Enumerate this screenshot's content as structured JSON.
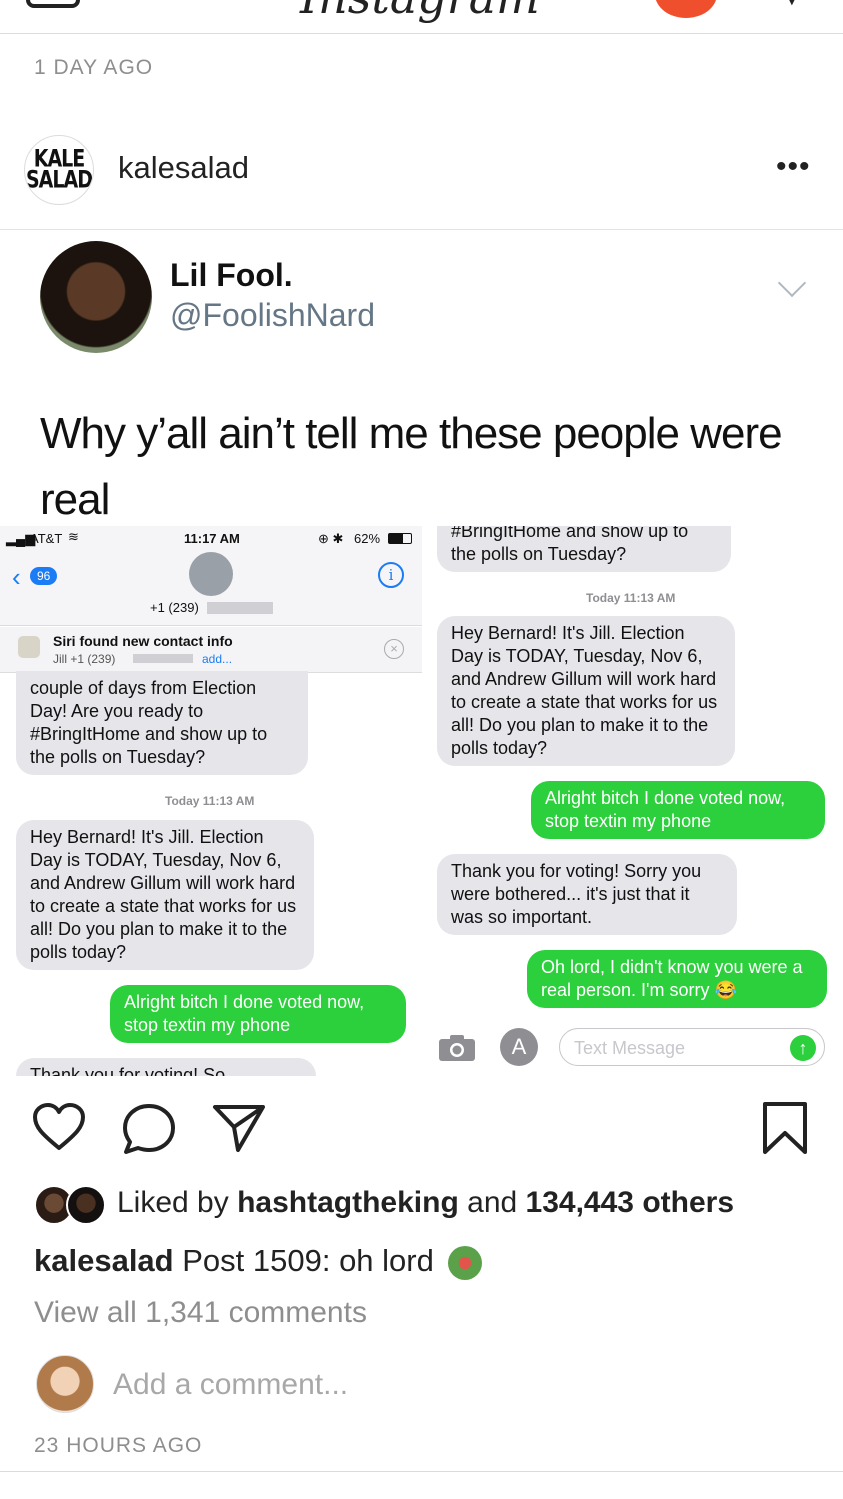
{
  "top": {
    "time_ago": "1 DAY AGO",
    "app_logo": "Instagram"
  },
  "author": {
    "username": "kalesalad",
    "avatar_text_line1": "KALE",
    "avatar_text_line2": "SALAD",
    "more_glyph": "•••"
  },
  "tweet": {
    "name": "Lil Fool.",
    "handle": "@FoolishNard",
    "text": "Why y’all ain’t tell me these people were real"
  },
  "sms_left": {
    "status": {
      "carrier": "AT&T",
      "time": "11:17 AM",
      "battery": "62%"
    },
    "back_count": "96",
    "contact": "+1 (239)",
    "siri_title": "Siri found new contact info",
    "siri_sub": "Jill +1 (239)",
    "siri_add": "add...",
    "msg1": "couple of days from Election Day! Are you ready to #BringItHome and show up to the polls on Tuesday?",
    "timestamp": "Today 11:13 AM",
    "msg2": "Hey Bernard! It's Jill. Election Day is TODAY, Tuesday, Nov 6, and Andrew Gillum will work hard to create a state that works for us all! Do you plan to make it to the polls today?",
    "reply1": "Alright bitch I done voted now, stop textin my phone",
    "cut_text": "Thank you for voting! So..."
  },
  "sms_right": {
    "msg0_cut": "#BringItHome and show up to",
    "msg0": "the polls on Tuesday?",
    "timestamp": "Today 11:13 AM",
    "msg1": "Hey Bernard! It's Jill. Election Day is TODAY, Tuesday, Nov 6, and Andrew Gillum will work hard to create a state that works for us all! Do you plan to make it to the polls today?",
    "reply1": "Alright bitch I done voted now, stop textin my phone",
    "msg2": "Thank you for voting! Sorry you were bothered... it's just that it was so important.",
    "reply2": "Oh lord, I didn't know you were a real person. I'm sorry 😂",
    "input_placeholder": "Text Message"
  },
  "engagement": {
    "liked_prefix": "Liked by",
    "liked_user": "hashtagtheking",
    "liked_and": "and",
    "liked_others": "134,443 others",
    "caption_user": "kalesalad",
    "caption_text": "Post 1509: oh lord",
    "view_all": "View all 1,341 comments",
    "add_comment": "Add a comment...",
    "time_ago": "23 HOURS AGO"
  },
  "icons": [
    "heart-icon",
    "comment-icon",
    "share-icon",
    "bookmark-icon",
    "camera-icon",
    "appstore-icon",
    "info-icon",
    "send-arrow-icon"
  ],
  "colors": {
    "imessage_green": "#2ccf3c",
    "bubble_gray": "#e5e5ea",
    "ios_blue": "#1b7cf5",
    "muted": "#8e8e8e"
  }
}
